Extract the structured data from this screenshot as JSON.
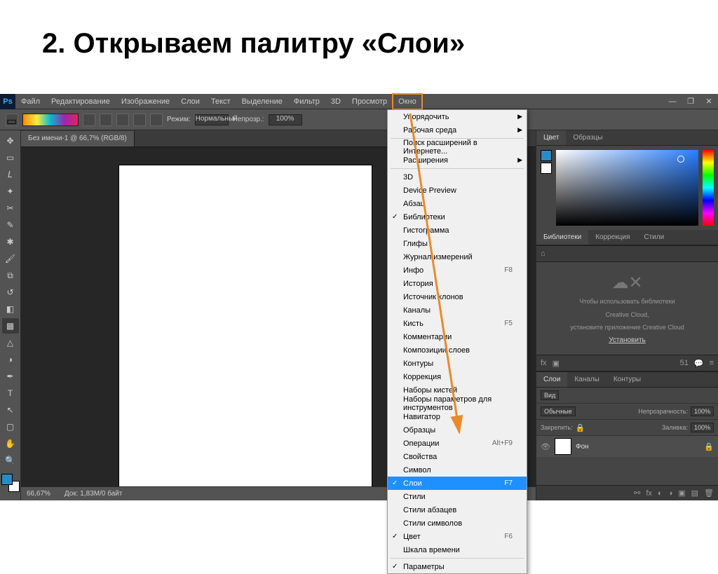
{
  "slide": {
    "title": "2. Открываем палитру «Слои»"
  },
  "menubar": {
    "items": [
      "Файл",
      "Редактирование",
      "Изображение",
      "Слои",
      "Текст",
      "Выделение",
      "Фильтр",
      "3D",
      "Просмотр",
      "Окно"
    ],
    "highlighted": "Окно"
  },
  "options": {
    "mode_label": "Режим:",
    "mode_value": "Нормальный",
    "opacity_label": "Непрозр.:",
    "opacity_value": "100%"
  },
  "document": {
    "tab": "Без имени-1 @ 66,7% (RGB/8)",
    "zoom": "66,67%",
    "docinfo": "Док: 1,83M/0 байт"
  },
  "colorPanel": {
    "tabs": [
      "Цвет",
      "Образцы"
    ]
  },
  "libPanel": {
    "tabs": [
      "Библиотеки",
      "Коррекция",
      "Стили"
    ],
    "msg1": "Чтобы использовать библиотеки",
    "msg2": "Creative Cloud,",
    "msg3": "установите приложение Creative Cloud",
    "link": "Установить"
  },
  "layersPanel": {
    "tabs": [
      "Слои",
      "Каналы",
      "Контуры"
    ],
    "kind": "Вид",
    "blend": "Обычные",
    "opacity_label": "Непрозрачность:",
    "opacity": "100%",
    "lock_label": "Закрепить:",
    "fill_label": "Заливка:",
    "fill": "100%",
    "layer_name": "Фон"
  },
  "dropdown": {
    "groups": [
      [
        {
          "label": "Упорядочить",
          "submenu": true
        },
        {
          "label": "Рабочая среда",
          "submenu": true
        }
      ],
      [
        {
          "label": "Поиск расширений в Интернете..."
        },
        {
          "label": "Расширения",
          "submenu": true
        }
      ],
      [
        {
          "label": "3D"
        },
        {
          "label": "Device Preview"
        },
        {
          "label": "Абзац"
        },
        {
          "label": "Библиотеки",
          "checked": true
        },
        {
          "label": "Гистограмма"
        },
        {
          "label": "Глифы"
        },
        {
          "label": "Журнал измерений"
        },
        {
          "label": "Инфо",
          "shortcut": "F8"
        },
        {
          "label": "История"
        },
        {
          "label": "Источник клонов"
        },
        {
          "label": "Каналы"
        },
        {
          "label": "Кисть",
          "shortcut": "F5"
        },
        {
          "label": "Комментарии"
        },
        {
          "label": "Композиции слоев"
        },
        {
          "label": "Контуры"
        },
        {
          "label": "Коррекция"
        },
        {
          "label": "Наборы кистей"
        },
        {
          "label": "Наборы параметров для инструментов"
        },
        {
          "label": "Навигатор"
        },
        {
          "label": "Образцы"
        },
        {
          "label": "Операции",
          "shortcut": "Alt+F9"
        },
        {
          "label": "Свойства"
        },
        {
          "label": "Символ"
        },
        {
          "label": "Слои",
          "shortcut": "F7",
          "checked": true,
          "highlighted": true
        },
        {
          "label": "Стили"
        },
        {
          "label": "Стили абзацев"
        },
        {
          "label": "Стили символов"
        },
        {
          "label": "Цвет",
          "shortcut": "F6",
          "checked": true
        },
        {
          "label": "Шкала времени"
        }
      ],
      [
        {
          "label": "Параметры",
          "checked": true
        }
      ]
    ]
  }
}
